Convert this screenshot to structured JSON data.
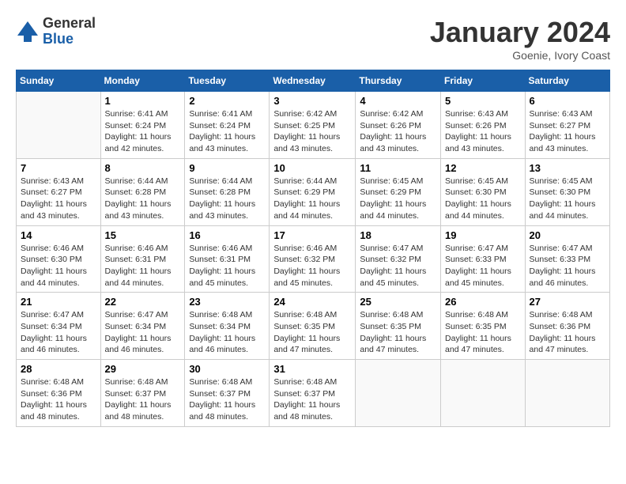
{
  "logo": {
    "general": "General",
    "blue": "Blue"
  },
  "title": "January 2024",
  "location": "Goenie, Ivory Coast",
  "days_header": [
    "Sunday",
    "Monday",
    "Tuesday",
    "Wednesday",
    "Thursday",
    "Friday",
    "Saturday"
  ],
  "weeks": [
    [
      {
        "day": "",
        "info": ""
      },
      {
        "day": "1",
        "info": "Sunrise: 6:41 AM\nSunset: 6:24 PM\nDaylight: 11 hours\nand 42 minutes."
      },
      {
        "day": "2",
        "info": "Sunrise: 6:41 AM\nSunset: 6:24 PM\nDaylight: 11 hours\nand 43 minutes."
      },
      {
        "day": "3",
        "info": "Sunrise: 6:42 AM\nSunset: 6:25 PM\nDaylight: 11 hours\nand 43 minutes."
      },
      {
        "day": "4",
        "info": "Sunrise: 6:42 AM\nSunset: 6:26 PM\nDaylight: 11 hours\nand 43 minutes."
      },
      {
        "day": "5",
        "info": "Sunrise: 6:43 AM\nSunset: 6:26 PM\nDaylight: 11 hours\nand 43 minutes."
      },
      {
        "day": "6",
        "info": "Sunrise: 6:43 AM\nSunset: 6:27 PM\nDaylight: 11 hours\nand 43 minutes."
      }
    ],
    [
      {
        "day": "7",
        "info": "Sunrise: 6:43 AM\nSunset: 6:27 PM\nDaylight: 11 hours\nand 43 minutes."
      },
      {
        "day": "8",
        "info": "Sunrise: 6:44 AM\nSunset: 6:28 PM\nDaylight: 11 hours\nand 43 minutes."
      },
      {
        "day": "9",
        "info": "Sunrise: 6:44 AM\nSunset: 6:28 PM\nDaylight: 11 hours\nand 43 minutes."
      },
      {
        "day": "10",
        "info": "Sunrise: 6:44 AM\nSunset: 6:29 PM\nDaylight: 11 hours\nand 44 minutes."
      },
      {
        "day": "11",
        "info": "Sunrise: 6:45 AM\nSunset: 6:29 PM\nDaylight: 11 hours\nand 44 minutes."
      },
      {
        "day": "12",
        "info": "Sunrise: 6:45 AM\nSunset: 6:30 PM\nDaylight: 11 hours\nand 44 minutes."
      },
      {
        "day": "13",
        "info": "Sunrise: 6:45 AM\nSunset: 6:30 PM\nDaylight: 11 hours\nand 44 minutes."
      }
    ],
    [
      {
        "day": "14",
        "info": "Sunrise: 6:46 AM\nSunset: 6:30 PM\nDaylight: 11 hours\nand 44 minutes."
      },
      {
        "day": "15",
        "info": "Sunrise: 6:46 AM\nSunset: 6:31 PM\nDaylight: 11 hours\nand 44 minutes."
      },
      {
        "day": "16",
        "info": "Sunrise: 6:46 AM\nSunset: 6:31 PM\nDaylight: 11 hours\nand 45 minutes."
      },
      {
        "day": "17",
        "info": "Sunrise: 6:46 AM\nSunset: 6:32 PM\nDaylight: 11 hours\nand 45 minutes."
      },
      {
        "day": "18",
        "info": "Sunrise: 6:47 AM\nSunset: 6:32 PM\nDaylight: 11 hours\nand 45 minutes."
      },
      {
        "day": "19",
        "info": "Sunrise: 6:47 AM\nSunset: 6:33 PM\nDaylight: 11 hours\nand 45 minutes."
      },
      {
        "day": "20",
        "info": "Sunrise: 6:47 AM\nSunset: 6:33 PM\nDaylight: 11 hours\nand 46 minutes."
      }
    ],
    [
      {
        "day": "21",
        "info": "Sunrise: 6:47 AM\nSunset: 6:34 PM\nDaylight: 11 hours\nand 46 minutes."
      },
      {
        "day": "22",
        "info": "Sunrise: 6:47 AM\nSunset: 6:34 PM\nDaylight: 11 hours\nand 46 minutes."
      },
      {
        "day": "23",
        "info": "Sunrise: 6:48 AM\nSunset: 6:34 PM\nDaylight: 11 hours\nand 46 minutes."
      },
      {
        "day": "24",
        "info": "Sunrise: 6:48 AM\nSunset: 6:35 PM\nDaylight: 11 hours\nand 47 minutes."
      },
      {
        "day": "25",
        "info": "Sunrise: 6:48 AM\nSunset: 6:35 PM\nDaylight: 11 hours\nand 47 minutes."
      },
      {
        "day": "26",
        "info": "Sunrise: 6:48 AM\nSunset: 6:35 PM\nDaylight: 11 hours\nand 47 minutes."
      },
      {
        "day": "27",
        "info": "Sunrise: 6:48 AM\nSunset: 6:36 PM\nDaylight: 11 hours\nand 47 minutes."
      }
    ],
    [
      {
        "day": "28",
        "info": "Sunrise: 6:48 AM\nSunset: 6:36 PM\nDaylight: 11 hours\nand 48 minutes."
      },
      {
        "day": "29",
        "info": "Sunrise: 6:48 AM\nSunset: 6:37 PM\nDaylight: 11 hours\nand 48 minutes."
      },
      {
        "day": "30",
        "info": "Sunrise: 6:48 AM\nSunset: 6:37 PM\nDaylight: 11 hours\nand 48 minutes."
      },
      {
        "day": "31",
        "info": "Sunrise: 6:48 AM\nSunset: 6:37 PM\nDaylight: 11 hours\nand 48 minutes."
      },
      {
        "day": "",
        "info": ""
      },
      {
        "day": "",
        "info": ""
      },
      {
        "day": "",
        "info": ""
      }
    ]
  ]
}
